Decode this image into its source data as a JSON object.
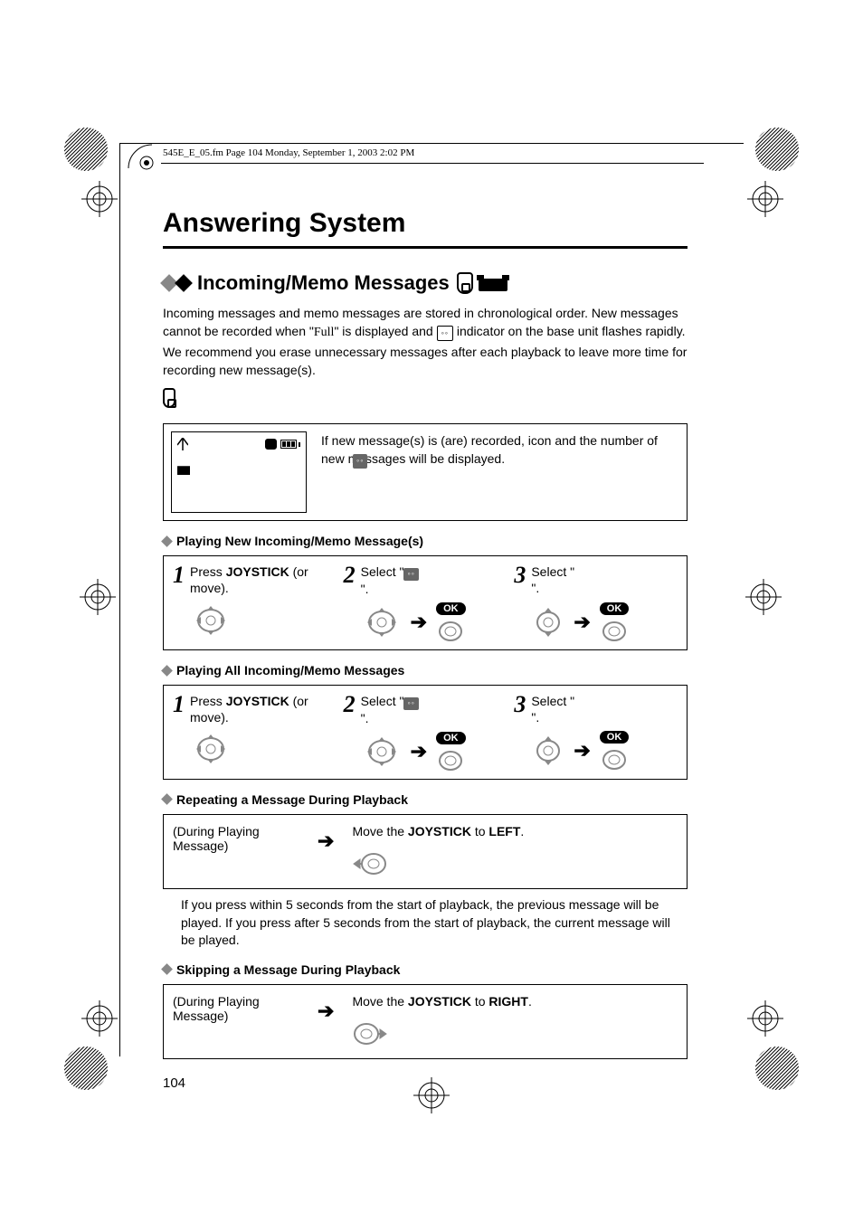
{
  "header_file": "545E_E_05.fm  Page 104  Monday, September 1, 2003  2:02 PM",
  "main_title": "Answering System",
  "section": {
    "title": "Incoming/Memo Messages",
    "intro_1": "Incoming messages and memo messages are stored in chronological order. New messages cannot be recorded when \"",
    "intro_full": "Full",
    "intro_2": "\" is displayed and ",
    "intro_3": " indicator on the base unit flashes rapidly. We recommend you erase unnecessary messages after each playback to leave more time for recording new message(s)."
  },
  "info_box_text": "If new message(s) is (are) recorded,       icon and the number of new messages will be displayed.",
  "sub_play_new": "Playing New Incoming/Memo Message(s)",
  "sub_play_all": "Playing All Incoming/Memo Messages",
  "sub_repeat": "Repeating a Message During Playback",
  "sub_skip": "Skipping a Message During Playback",
  "steps": {
    "s1_text_a": "Press ",
    "s1_bold": "JOYSTICK",
    "s1_text_b": " (or move).",
    "s2_text_a": "Select \"",
    "s2_text_b": "\".",
    "s3_text_a": "Select \"",
    "s3_text_b": "\".",
    "ok": "OK"
  },
  "repeat": {
    "during": "(During Playing Message)",
    "move_a": "Move the ",
    "move_bold1": "JOYSTICK",
    "move_mid": " to ",
    "move_bold_left": "LEFT",
    "move_bold_right": "RIGHT",
    "move_end": ".",
    "note": "If you press within 5 seconds from the start of playback, the previous message will be played. If you press after 5 seconds from the start of playback, the current message will be played."
  },
  "page_number": "104"
}
